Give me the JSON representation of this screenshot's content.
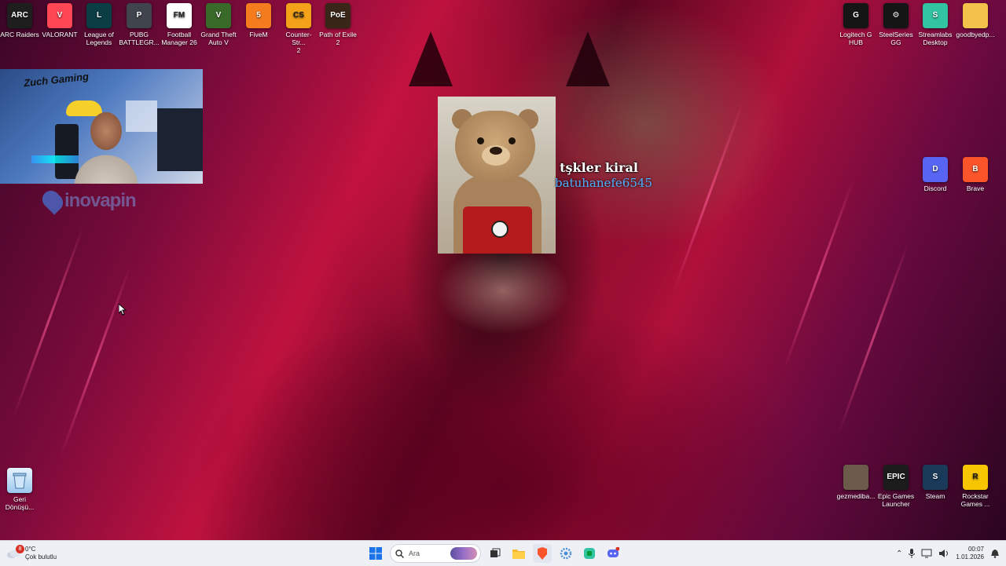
{
  "desktop_icons_top_left": [
    {
      "label": "ARC Raiders",
      "color": "#1e1e1e",
      "glyph": "ARC"
    },
    {
      "label": "VALORANT",
      "color": "#ff4655",
      "glyph": "V"
    },
    {
      "label": "League of\nLegends",
      "color": "#0a3e44",
      "glyph": "L"
    },
    {
      "label": "PUBG\nBATTLEGR...",
      "color": "#40444c",
      "glyph": "P"
    },
    {
      "label": "Football\nManager 26",
      "color": "#ffffff",
      "glyph": "FM"
    },
    {
      "label": "Grand Theft\nAuto V",
      "color": "#3a6a2a",
      "glyph": "V"
    },
    {
      "label": "FiveM",
      "color": "#f57b1f",
      "glyph": "5"
    },
    {
      "label": "Counter-Str...\n2",
      "color": "#f3a21a",
      "glyph": "CS"
    },
    {
      "label": "Path of Exile\n2",
      "color": "#3a2618",
      "glyph": "PoE"
    }
  ],
  "desktop_icons_top_right": [
    {
      "label": "Logitech G\nHUB",
      "color": "#151515",
      "glyph": "G"
    },
    {
      "label": "SteelSeries\nGG",
      "color": "#151515",
      "glyph": "⚙"
    },
    {
      "label": "Streamlabs\nDesktop",
      "color": "#31c3a2",
      "glyph": "S"
    },
    {
      "label": "goodbyedp...",
      "color": "#f2c24b",
      "glyph": ""
    }
  ],
  "desktop_icons_mid_right": [
    {
      "label": "Discord",
      "color": "#5865f2",
      "glyph": "D"
    },
    {
      "label": "Brave",
      "color": "#fb542b",
      "glyph": "B"
    }
  ],
  "desktop_icons_bottom_right": [
    {
      "label": "gezmediba...",
      "color": "#6b5a4a",
      "glyph": ""
    },
    {
      "label": "Epic Games\nLauncher",
      "color": "#1c1c1c",
      "glyph": "EPIC"
    },
    {
      "label": "Steam",
      "color": "#1b3a5a",
      "glyph": "S"
    },
    {
      "label": "Rockstar\nGames ...",
      "color": "#f7c600",
      "glyph": "R"
    }
  ],
  "recycle_bin": {
    "label": "Geri\nDönüşü..."
  },
  "stream_overlay": {
    "watermark": "inovapin",
    "alert_message": "tşkler kiral",
    "alert_username": "batuhanefe6545"
  },
  "webcam_text": "Zuch Gaming",
  "taskbar": {
    "weather_temp": "0°C",
    "weather_desc": "Çok bulutlu",
    "weather_badge": "8",
    "search_placeholder": "Ara",
    "clock_time": "00:07",
    "clock_date": "1.01.2026"
  }
}
